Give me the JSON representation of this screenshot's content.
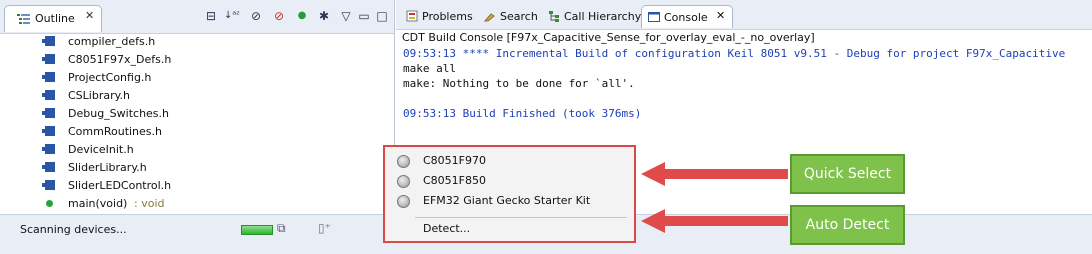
{
  "outline": {
    "tab_label": "Outline",
    "toolbar_icons": [
      "collapse-all-icon",
      "sort-az-icon",
      "hide-fields-icon",
      "hide-static-icon",
      "hide-nonpublic-icon",
      "hide-local-types-icon",
      "view-menu-icon",
      "minimize-icon",
      "maximize-icon"
    ],
    "items": [
      {
        "label": "compiler_defs.h",
        "icon": "header-file-icon"
      },
      {
        "label": "C8051F97x_Defs.h",
        "icon": "header-file-icon"
      },
      {
        "label": "ProjectConfig.h",
        "icon": "header-file-icon"
      },
      {
        "label": "CSLibrary.h",
        "icon": "header-file-icon"
      },
      {
        "label": "Debug_Switches.h",
        "icon": "header-file-icon"
      },
      {
        "label": "CommRoutines.h",
        "icon": "header-file-icon"
      },
      {
        "label": "DeviceInit.h",
        "icon": "header-file-icon"
      },
      {
        "label": "SliderLibrary.h",
        "icon": "header-file-icon"
      },
      {
        "label": "SliderLEDControl.h",
        "icon": "header-file-icon"
      },
      {
        "label": "main(void)",
        "suffix": " : void",
        "icon": "function-icon"
      }
    ]
  },
  "tabs": [
    {
      "label": "Problems",
      "icon": "problems-icon"
    },
    {
      "label": "Search",
      "icon": "search-icon"
    },
    {
      "label": "Call Hierarchy",
      "icon": "call-hierarchy-icon"
    },
    {
      "label": "Console",
      "icon": "console-icon",
      "active": true
    }
  ],
  "console": {
    "title": "CDT Build Console [F97x_Capacitive_Sense_for_overlay_eval_-_no_overlay]",
    "lines": [
      {
        "text": "09:53:13 **** Incremental Build of configuration Keil 8051 v9.51 - Debug for project F97x_Capacitive",
        "color": "blue"
      },
      {
        "text": "make all",
        "color": "black"
      },
      {
        "text": "make: Nothing to be done for `all'.",
        "color": "black"
      },
      {
        "text": "",
        "color": "black"
      },
      {
        "text": "09:53:13 Build Finished (took 376ms)",
        "color": "blue"
      }
    ]
  },
  "popup": {
    "items": [
      "C8051F970",
      "C8051F850",
      "EFM32 Giant Gecko Starter Kit"
    ],
    "detect_label": "Detect..."
  },
  "callouts": {
    "quick_select": "Quick Select",
    "auto_detect": "Auto Detect"
  },
  "status": {
    "text": "Scanning devices..."
  },
  "colors": {
    "accent_red": "#e04a4a",
    "callout_green": "#7fc24b",
    "console_blue": "#1c3fb8"
  }
}
